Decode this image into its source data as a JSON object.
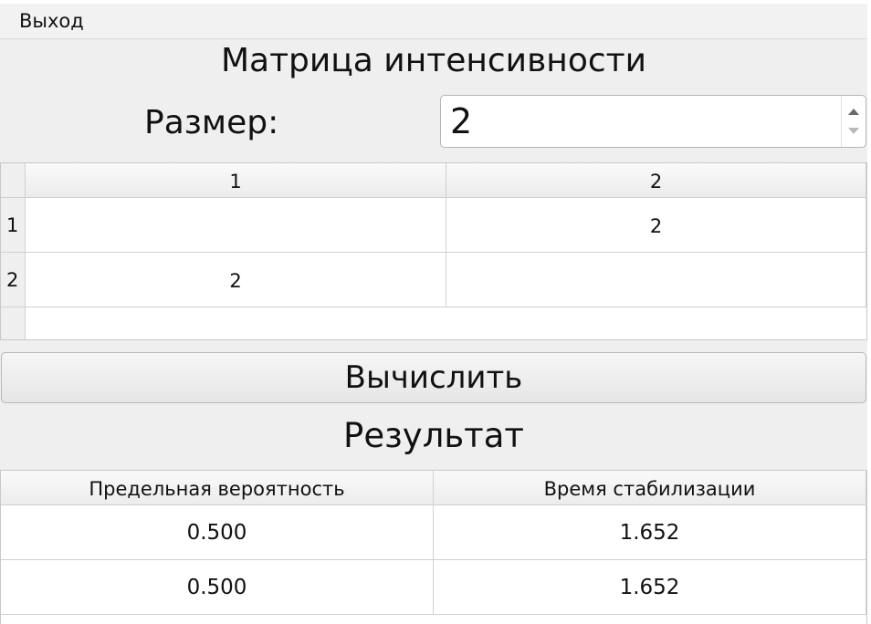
{
  "menu": {
    "exit_label": "Выход"
  },
  "matrix_section": {
    "title": "Матрица интенсивности",
    "size_label": "Размер:",
    "size_value": "2"
  },
  "matrix_table": {
    "column_headers": [
      "1",
      "2"
    ],
    "row_headers": [
      "1",
      "2"
    ],
    "rows": [
      [
        "",
        "2"
      ],
      [
        "2",
        ""
      ]
    ]
  },
  "compute_button_label": "Вычислить",
  "result_section": {
    "title": "Результат"
  },
  "result_table": {
    "column_headers": [
      "Предельная вероятность",
      "Время стабилизации"
    ],
    "rows": [
      [
        "0.500",
        "1.652"
      ],
      [
        "0.500",
        "1.652"
      ]
    ]
  },
  "colors": {
    "window_background": "#efefef",
    "table_background": "#ffffff",
    "grid_line": "#d0d0d0"
  }
}
